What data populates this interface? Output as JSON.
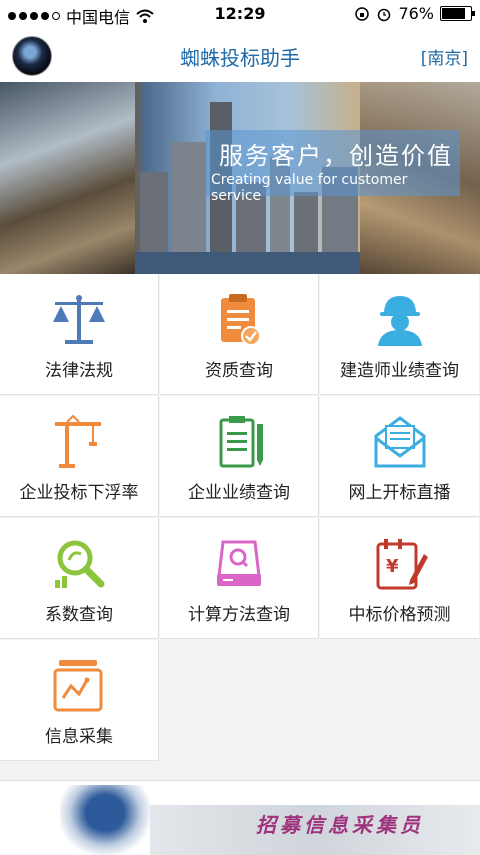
{
  "status_bar": {
    "carrier": "中国电信",
    "time": "12:29",
    "battery": "76%",
    "battery_level": 0.76
  },
  "header": {
    "title": "蜘蛛投标助手",
    "city": "[南京]"
  },
  "banner": {
    "slogan_cn": "服务客户，创造价值",
    "slogan_en": "Creating value for customer service"
  },
  "menu": [
    {
      "label": "法律法规",
      "icon": "scales-icon",
      "color": "#4e7bb8"
    },
    {
      "label": "资质查询",
      "icon": "clipboard-check-icon",
      "color": "#f08a3c"
    },
    {
      "label": "建造师业绩查询",
      "icon": "worker-helmet-icon",
      "color": "#3aaee0"
    },
    {
      "label": "企业投标下浮率",
      "icon": "crane-icon",
      "color": "#f08a3c"
    },
    {
      "label": "企业业绩查询",
      "icon": "notepad-pen-icon",
      "color": "#3a9a4a"
    },
    {
      "label": "网上开标直播",
      "icon": "envelope-icon",
      "color": "#3aaee0"
    },
    {
      "label": "系数查询",
      "icon": "magnifier-chart-icon",
      "color": "#8cc43c"
    },
    {
      "label": "计算方法查询",
      "icon": "drive-search-icon",
      "color": "#d965c6"
    },
    {
      "label": "中标价格预测",
      "icon": "calendar-yen-icon",
      "color": "#c0392b"
    },
    {
      "label": "信息采集",
      "icon": "folder-chart-icon",
      "color": "#f08a3c"
    }
  ],
  "ad_banner": {
    "text": "招募信息采集员"
  }
}
